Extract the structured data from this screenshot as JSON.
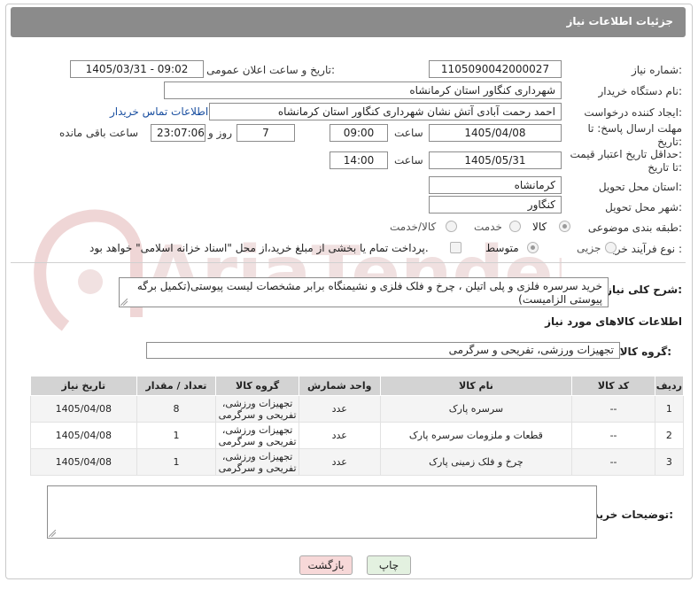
{
  "header": {
    "title": "جزئیات اطلاعات نیاز"
  },
  "form": {
    "need_number": {
      "label": "شماره نیاز:",
      "value": "1105090042000027"
    },
    "announce_datetime": {
      "label": "تاریخ و ساعت اعلان عمومی:",
      "value": "1405/03/31 - 09:02"
    },
    "buyer_org": {
      "label": "نام دستگاه خریدار:",
      "value": "شهرداری کنگاور استان کرمانشاه"
    },
    "requester": {
      "label": "ایجاد کننده درخواست:",
      "value": "احمد رحمت آبادی آتش نشان شهرداری کنگاور استان کرمانشاه",
      "contact_link": "اطلاعات تماس خریدار"
    },
    "reply_deadline": {
      "label_line1": "مهلت ارسال پاسخ: تا",
      "label_line2": "تاریخ:",
      "date": "1405/04/08",
      "time_label": "ساعت",
      "time": "09:00",
      "days": "7",
      "days_label": "روز و",
      "remaining": "23:07:06",
      "remaining_label": "ساعت باقی مانده"
    },
    "price_validity": {
      "label_line1": "حداقل تاریخ اعتبار قیمت:",
      "label_line2": "تا تاریخ:",
      "date": "1405/05/31",
      "time_label": "ساعت",
      "time": "14:00"
    },
    "delivery_province": {
      "label": "استان محل تحویل:",
      "value": "کرمانشاه"
    },
    "delivery_city": {
      "label": "شهر محل تحویل:",
      "value": "کنگاور"
    },
    "category": {
      "label": "طبقه بندی موضوعی:",
      "options": [
        "کالا",
        "خدمت",
        "کالا/خدمت"
      ],
      "selected": "کالا"
    },
    "purchase_type": {
      "label": "نوع فرآیند خرید :",
      "options": [
        "جزیی",
        "متوسط"
      ],
      "selected": "متوسط",
      "payment_note": "پرداخت تمام یا بخشی از مبلغ خرید،از محل \"اسناد خزانه اسلامی\" خواهد بود."
    }
  },
  "description": {
    "label": "شرح کلی نیاز:",
    "value": "خرید سرسره فلزی و پلی اتیلن ، چرخ و فلک فلزی و نشیمنگاه برابر مشخصات لیست پیوستی(تکمیل برگه پیوستی الزامیست)"
  },
  "goods_info": {
    "title": "اطلاعات کالاهای مورد نیاز",
    "group_label": "گروه کالا:",
    "group_value": "تجهیزات ورزشی، تفریحی و سرگرمی"
  },
  "table": {
    "headers": [
      "ردیف",
      "کد کالا",
      "نام کالا",
      "واحد شمارش",
      "گروه کالا",
      "تعداد / مقدار",
      "تاریخ نیاز"
    ],
    "rows": [
      {
        "row": "1",
        "code": "--",
        "name": "سرسره پارک",
        "unit": "عدد",
        "group": "تجهیزات ورزشی، تفریحی و سرگرمی",
        "qty": "8",
        "date": "1405/04/08"
      },
      {
        "row": "2",
        "code": "--",
        "name": "قطعات و ملزومات سرسره پارک",
        "unit": "عدد",
        "group": "تجهیزات ورزشی، تفریحی و سرگرمی",
        "qty": "1",
        "date": "1405/04/08"
      },
      {
        "row": "3",
        "code": "--",
        "name": "چرخ و فلک زمینی پارک",
        "unit": "عدد",
        "group": "تجهیزات ورزشی، تفریحی و سرگرمی",
        "qty": "1",
        "date": "1405/04/08"
      }
    ]
  },
  "buyer_notes": {
    "label": "توضیحات خریدار:",
    "value": ""
  },
  "buttons": {
    "print": "چاپ",
    "back": "بازگشت"
  },
  "colors": {
    "header_bg": "#8b8b8b",
    "link": "#1a4fa0",
    "back_button_bg": "#f7d8d8",
    "print_button_bg": "#e3f1e0"
  },
  "watermark": {
    "text": "AriaTender.net"
  }
}
